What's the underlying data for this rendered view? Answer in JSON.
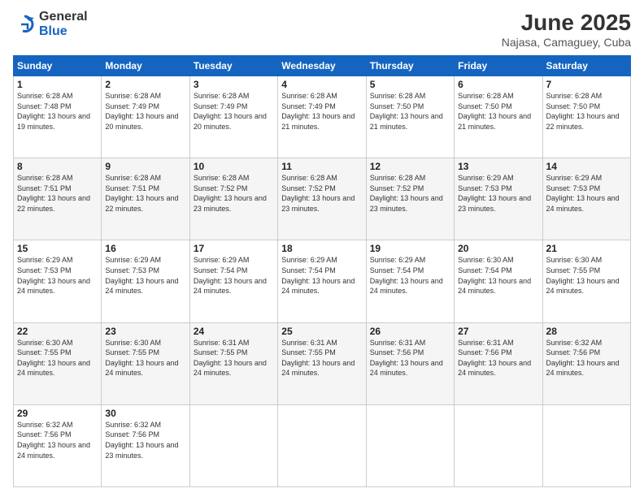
{
  "logo": {
    "general": "General",
    "blue": "Blue"
  },
  "title": "June 2025",
  "subtitle": "Najasa, Camaguey, Cuba",
  "days_of_week": [
    "Sunday",
    "Monday",
    "Tuesday",
    "Wednesday",
    "Thursday",
    "Friday",
    "Saturday"
  ],
  "weeks": [
    [
      {
        "day": "1",
        "sunrise": "6:28 AM",
        "sunset": "7:48 PM",
        "daylight": "13 hours and 19 minutes."
      },
      {
        "day": "2",
        "sunrise": "6:28 AM",
        "sunset": "7:49 PM",
        "daylight": "13 hours and 20 minutes."
      },
      {
        "day": "3",
        "sunrise": "6:28 AM",
        "sunset": "7:49 PM",
        "daylight": "13 hours and 20 minutes."
      },
      {
        "day": "4",
        "sunrise": "6:28 AM",
        "sunset": "7:49 PM",
        "daylight": "13 hours and 21 minutes."
      },
      {
        "day": "5",
        "sunrise": "6:28 AM",
        "sunset": "7:50 PM",
        "daylight": "13 hours and 21 minutes."
      },
      {
        "day": "6",
        "sunrise": "6:28 AM",
        "sunset": "7:50 PM",
        "daylight": "13 hours and 21 minutes."
      },
      {
        "day": "7",
        "sunrise": "6:28 AM",
        "sunset": "7:50 PM",
        "daylight": "13 hours and 22 minutes."
      }
    ],
    [
      {
        "day": "8",
        "sunrise": "6:28 AM",
        "sunset": "7:51 PM",
        "daylight": "13 hours and 22 minutes."
      },
      {
        "day": "9",
        "sunrise": "6:28 AM",
        "sunset": "7:51 PM",
        "daylight": "13 hours and 22 minutes."
      },
      {
        "day": "10",
        "sunrise": "6:28 AM",
        "sunset": "7:52 PM",
        "daylight": "13 hours and 23 minutes."
      },
      {
        "day": "11",
        "sunrise": "6:28 AM",
        "sunset": "7:52 PM",
        "daylight": "13 hours and 23 minutes."
      },
      {
        "day": "12",
        "sunrise": "6:28 AM",
        "sunset": "7:52 PM",
        "daylight": "13 hours and 23 minutes."
      },
      {
        "day": "13",
        "sunrise": "6:29 AM",
        "sunset": "7:53 PM",
        "daylight": "13 hours and 23 minutes."
      },
      {
        "day": "14",
        "sunrise": "6:29 AM",
        "sunset": "7:53 PM",
        "daylight": "13 hours and 24 minutes."
      }
    ],
    [
      {
        "day": "15",
        "sunrise": "6:29 AM",
        "sunset": "7:53 PM",
        "daylight": "13 hours and 24 minutes."
      },
      {
        "day": "16",
        "sunrise": "6:29 AM",
        "sunset": "7:53 PM",
        "daylight": "13 hours and 24 minutes."
      },
      {
        "day": "17",
        "sunrise": "6:29 AM",
        "sunset": "7:54 PM",
        "daylight": "13 hours and 24 minutes."
      },
      {
        "day": "18",
        "sunrise": "6:29 AM",
        "sunset": "7:54 PM",
        "daylight": "13 hours and 24 minutes."
      },
      {
        "day": "19",
        "sunrise": "6:29 AM",
        "sunset": "7:54 PM",
        "daylight": "13 hours and 24 minutes."
      },
      {
        "day": "20",
        "sunrise": "6:30 AM",
        "sunset": "7:54 PM",
        "daylight": "13 hours and 24 minutes."
      },
      {
        "day": "21",
        "sunrise": "6:30 AM",
        "sunset": "7:55 PM",
        "daylight": "13 hours and 24 minutes."
      }
    ],
    [
      {
        "day": "22",
        "sunrise": "6:30 AM",
        "sunset": "7:55 PM",
        "daylight": "13 hours and 24 minutes."
      },
      {
        "day": "23",
        "sunrise": "6:30 AM",
        "sunset": "7:55 PM",
        "daylight": "13 hours and 24 minutes."
      },
      {
        "day": "24",
        "sunrise": "6:31 AM",
        "sunset": "7:55 PM",
        "daylight": "13 hours and 24 minutes."
      },
      {
        "day": "25",
        "sunrise": "6:31 AM",
        "sunset": "7:55 PM",
        "daylight": "13 hours and 24 minutes."
      },
      {
        "day": "26",
        "sunrise": "6:31 AM",
        "sunset": "7:56 PM",
        "daylight": "13 hours and 24 minutes."
      },
      {
        "day": "27",
        "sunrise": "6:31 AM",
        "sunset": "7:56 PM",
        "daylight": "13 hours and 24 minutes."
      },
      {
        "day": "28",
        "sunrise": "6:32 AM",
        "sunset": "7:56 PM",
        "daylight": "13 hours and 24 minutes."
      }
    ],
    [
      {
        "day": "29",
        "sunrise": "6:32 AM",
        "sunset": "7:56 PM",
        "daylight": "13 hours and 24 minutes."
      },
      {
        "day": "30",
        "sunrise": "6:32 AM",
        "sunset": "7:56 PM",
        "daylight": "13 hours and 23 minutes."
      },
      null,
      null,
      null,
      null,
      null
    ]
  ],
  "labels": {
    "sunrise": "Sunrise:",
    "sunset": "Sunset:",
    "daylight": "Daylight:"
  }
}
